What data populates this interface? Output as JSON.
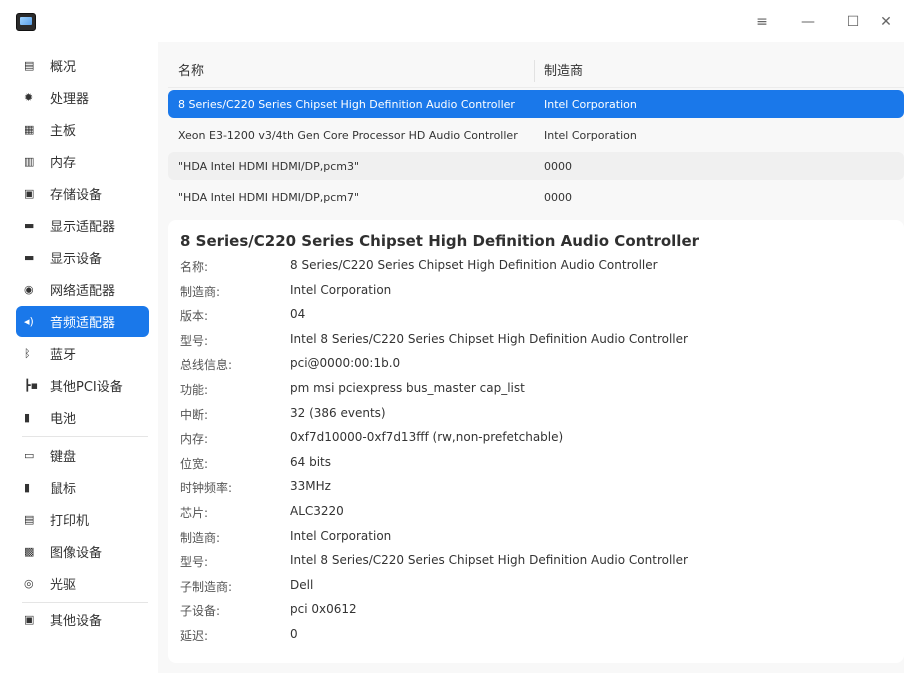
{
  "window": {
    "menu_icon": "≡",
    "minimize_icon": "—",
    "maximize_icon": "☐",
    "close_icon": "✕"
  },
  "sidebar": {
    "items": [
      {
        "label": "概况",
        "icon": "overview-icon",
        "glyph": "▤"
      },
      {
        "label": "处理器",
        "icon": "cpu-icon",
        "glyph": "✹"
      },
      {
        "label": "主板",
        "icon": "motherboard-icon",
        "glyph": "▦"
      },
      {
        "label": "内存",
        "icon": "memory-icon",
        "glyph": "▥"
      },
      {
        "label": "存储设备",
        "icon": "storage-icon",
        "glyph": "▣"
      },
      {
        "label": "显示适配器",
        "icon": "display-adapter-icon",
        "glyph": "▬"
      },
      {
        "label": "显示设备",
        "icon": "monitor-icon",
        "glyph": "▬"
      },
      {
        "label": "网络适配器",
        "icon": "network-icon",
        "glyph": "◉"
      },
      {
        "label": "音频适配器",
        "icon": "audio-icon",
        "glyph": "◂)"
      },
      {
        "label": "蓝牙",
        "icon": "bluetooth-icon",
        "glyph": "ᛒ"
      },
      {
        "label": "其他PCI设备",
        "icon": "pci-icon",
        "glyph": "┣▪"
      },
      {
        "label": "电池",
        "icon": "battery-icon",
        "glyph": "▮"
      },
      {
        "label": "键盘",
        "icon": "keyboard-icon",
        "glyph": "▭"
      },
      {
        "label": "鼠标",
        "icon": "mouse-icon",
        "glyph": "▮"
      },
      {
        "label": "打印机",
        "icon": "printer-icon",
        "glyph": "▤"
      },
      {
        "label": "图像设备",
        "icon": "camera-icon",
        "glyph": "▩"
      },
      {
        "label": "光驱",
        "icon": "optical-drive-icon",
        "glyph": "◎"
      },
      {
        "label": "其他设备",
        "icon": "other-device-icon",
        "glyph": "▣"
      }
    ],
    "active_index": 8
  },
  "table": {
    "headers": [
      "名称",
      "制造商"
    ],
    "rows": [
      {
        "name": "8 Series/C220 Series Chipset High Definition Audio Controller",
        "vendor": "Intel Corporation"
      },
      {
        "name": "Xeon E3-1200 v3/4th Gen Core Processor HD Audio Controller",
        "vendor": "Intel Corporation"
      },
      {
        "name": "\"HDA Intel HDMI HDMI/DP,pcm3\"",
        "vendor": "0000"
      },
      {
        "name": "\"HDA Intel HDMI HDMI/DP,pcm7\"",
        "vendor": "0000"
      }
    ],
    "selected_index": 0
  },
  "detail": {
    "title": "8 Series/C220 Series Chipset High Definition Audio Controller",
    "fields": [
      {
        "key": "名称:",
        "value": "8 Series/C220 Series Chipset High Definition Audio Controller"
      },
      {
        "key": "制造商:",
        "value": "Intel Corporation"
      },
      {
        "key": "版本:",
        "value": "04"
      },
      {
        "key": "型号:",
        "value": "Intel 8 Series/C220 Series Chipset High Definition Audio Controller"
      },
      {
        "key": "总线信息:",
        "value": "pci@0000:00:1b.0"
      },
      {
        "key": "功能:",
        "value": "pm msi pciexpress bus_master cap_list"
      },
      {
        "key": "中断:",
        "value": "32 (386 events)"
      },
      {
        "key": "内存:",
        "value": "0xf7d10000-0xf7d13fff (rw,non-prefetchable)"
      },
      {
        "key": "位宽:",
        "value": "64 bits"
      },
      {
        "key": "时钟频率:",
        "value": "33MHz"
      },
      {
        "key": "芯片:",
        "value": "ALC3220"
      },
      {
        "key": "制造商:",
        "value": "Intel Corporation"
      },
      {
        "key": "型号:",
        "value": "Intel 8 Series/C220 Series Chipset High Definition Audio Controller"
      },
      {
        "key": "子制造商:",
        "value": "Dell"
      },
      {
        "key": "子设备:",
        "value": "pci 0x0612"
      },
      {
        "key": "延迟:",
        "value": "0"
      }
    ]
  },
  "colors": {
    "accent": "#1a78ea",
    "background": "#f8f8f8",
    "card": "#ffffff"
  }
}
